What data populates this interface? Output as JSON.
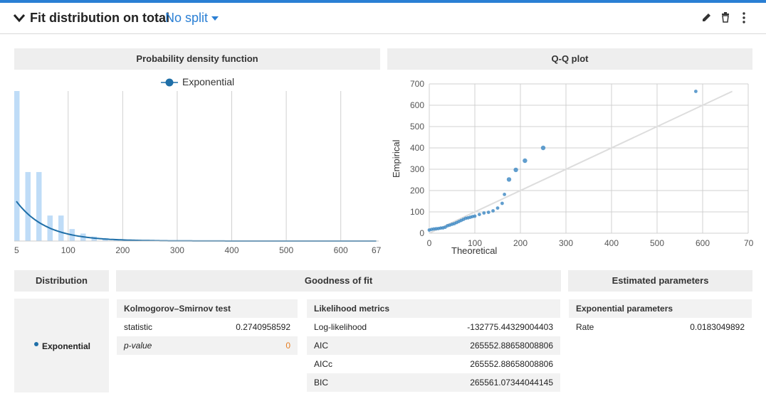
{
  "header": {
    "title": "Fit distribution on total",
    "split_label": "No split",
    "icons": [
      "edit-icon",
      "trash-icon",
      "more-vertical-icon"
    ]
  },
  "pdf_panel": {
    "title": "Probability density function",
    "legend_label": "Exponential",
    "x_ticks": [
      "5",
      "100",
      "200",
      "300",
      "400",
      "500",
      "600",
      "67"
    ]
  },
  "qq_panel": {
    "title": "Q-Q plot",
    "xlabel": "Theoretical",
    "ylabel": "Empirical",
    "x_ticks": [
      "0",
      "100",
      "200",
      "300",
      "400",
      "500",
      "600",
      "70"
    ],
    "y_ticks": [
      "0",
      "100",
      "200",
      "300",
      "400",
      "500",
      "600",
      "700"
    ]
  },
  "chart_data": [
    {
      "type": "bar",
      "title": "Probability density function",
      "series": [
        {
          "name": "Exponential",
          "type": "line"
        }
      ],
      "xlim": [
        5,
        667
      ],
      "histogram_relative_heights": [
        1.0,
        0.46,
        0.46,
        0.17,
        0.17,
        0.08,
        0.05,
        0.03,
        0.02,
        0.01,
        0.01
      ]
    },
    {
      "type": "scatter",
      "title": "Q-Q plot",
      "xlabel": "Theoretical",
      "ylabel": "Empirical",
      "xlim": [
        0,
        700
      ],
      "ylim": [
        0,
        700
      ],
      "points": [
        [
          0,
          15
        ],
        [
          5,
          18
        ],
        [
          10,
          20
        ],
        [
          15,
          21
        ],
        [
          20,
          22
        ],
        [
          25,
          24
        ],
        [
          30,
          25
        ],
        [
          35,
          28
        ],
        [
          40,
          35
        ],
        [
          45,
          38
        ],
        [
          50,
          42
        ],
        [
          55,
          45
        ],
        [
          60,
          50
        ],
        [
          65,
          55
        ],
        [
          70,
          60
        ],
        [
          75,
          65
        ],
        [
          80,
          70
        ],
        [
          85,
          72
        ],
        [
          90,
          75
        ],
        [
          95,
          78
        ],
        [
          100,
          80
        ],
        [
          110,
          88
        ],
        [
          120,
          95
        ],
        [
          130,
          98
        ],
        [
          140,
          105
        ],
        [
          150,
          118
        ],
        [
          160,
          140
        ],
        [
          165,
          182
        ],
        [
          175,
          252
        ],
        [
          190,
          297
        ],
        [
          210,
          340
        ],
        [
          250,
          400
        ],
        [
          585,
          665
        ]
      ],
      "reference_line": [
        [
          0,
          0
        ],
        [
          665,
          665
        ]
      ]
    }
  ],
  "table": {
    "distribution_header": "Distribution",
    "goodness_header": "Goodness of fit",
    "params_header": "Estimated parameters",
    "distribution_name": "Exponential",
    "ks": {
      "title": "Kolmogorov–Smirnov test",
      "rows": [
        {
          "label": "statistic",
          "value": "0.2740958592"
        },
        {
          "label": "p-value",
          "value": "0"
        }
      ]
    },
    "likelihood": {
      "title": "Likelihood metrics",
      "rows": [
        {
          "label": "Log-likelihood",
          "value": "-132775.44329004403"
        },
        {
          "label": "AIC",
          "value": "265552.88658008806"
        },
        {
          "label": "AICc",
          "value": "265552.88658008806"
        },
        {
          "label": "BIC",
          "value": "265561.07344044145"
        }
      ]
    },
    "params": {
      "title": "Exponential parameters",
      "rows": [
        {
          "label": "Rate",
          "value": "0.0183049892"
        }
      ]
    }
  },
  "colors": {
    "accent": "#2a7fd4",
    "series": "#1f6fa8",
    "histogram": "#bfdcf7",
    "pvalue": "#e67e22"
  }
}
